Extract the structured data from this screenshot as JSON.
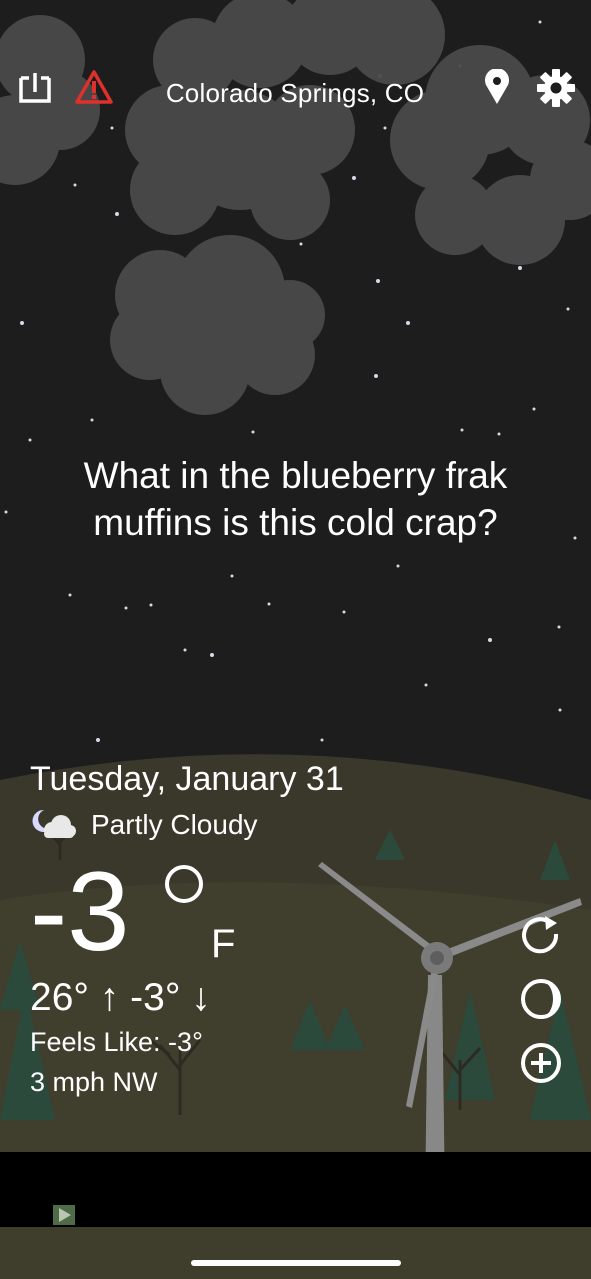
{
  "header": {
    "location": "Colorado Springs, CO",
    "icons": [
      "share-icon",
      "alert-icon",
      "location-pin-icon",
      "gear-icon"
    ]
  },
  "message": "What in the blueberry frak muffins is this cold crap?",
  "weather": {
    "date": "Tuesday, January 31",
    "condition": "Partly Cloudy",
    "condition_icon": "partly-cloudy-night-icon",
    "temperature": "-3",
    "unit": "F",
    "high_low": "26° ↑  -3° ↓",
    "feels_like": "Feels Like: -3°",
    "wind": "3 mph NW"
  },
  "actions": [
    "refresh-icon",
    "moon-phase-icon",
    "add-icon"
  ],
  "colors": {
    "sky": "#1d1d1e",
    "cloud": "#4a4a4a",
    "ground": "#3f3d2b",
    "alert_red": "#e0302c",
    "text": "#ffffff"
  }
}
